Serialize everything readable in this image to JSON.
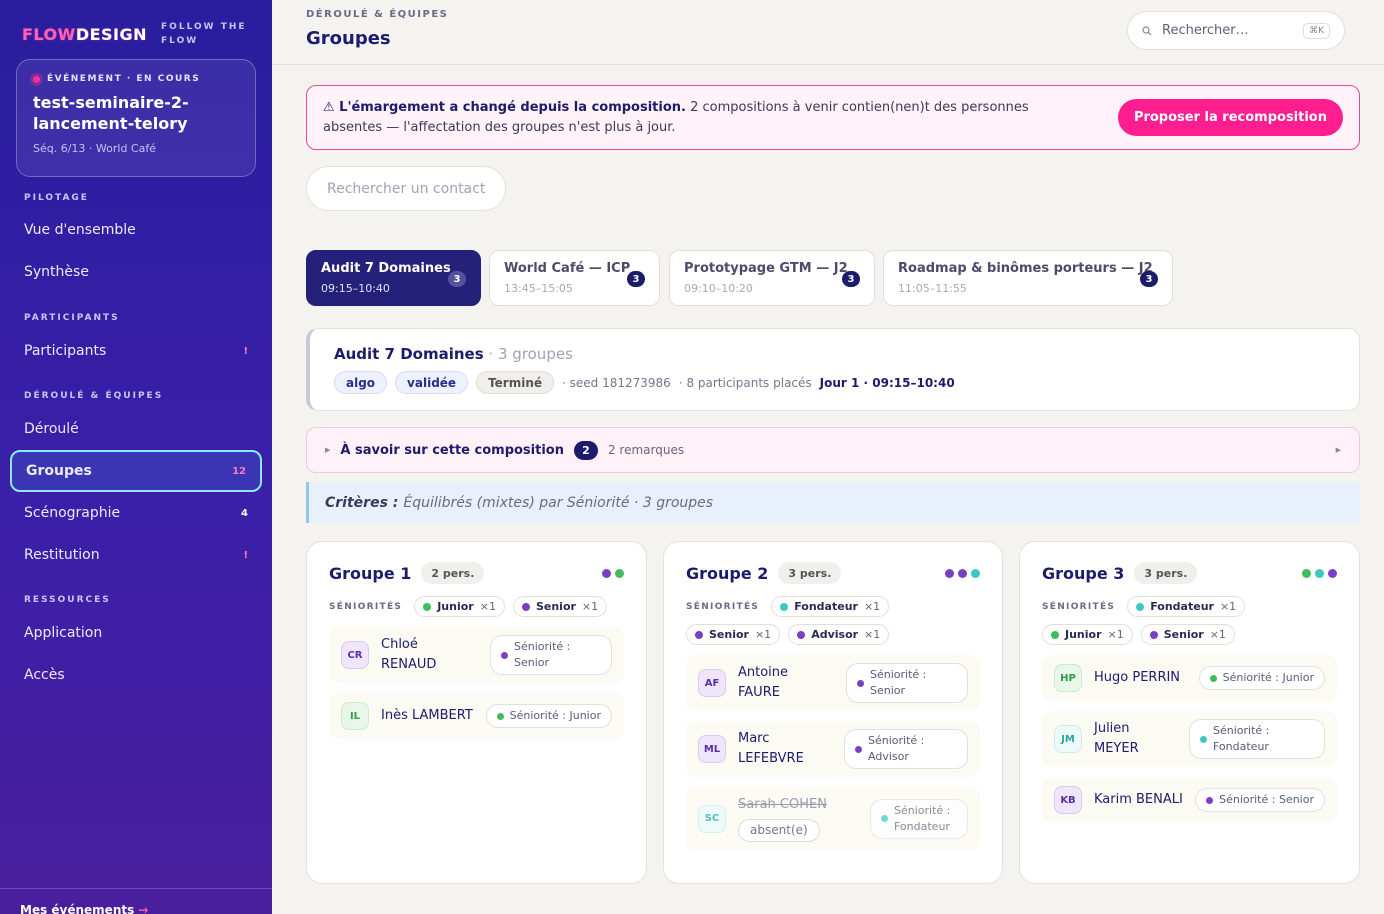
{
  "sidebar": {
    "logo_a": "FLOW",
    "logo_b": "DESIGN",
    "tagline_1": "FOLLOW THE",
    "tagline_2": "FLOW",
    "event": {
      "status": "ÉVÉNEMENT · EN COURS",
      "name": "test-seminaire-2-lancement-telory",
      "meta": "Séq. 6/13 · World Café"
    },
    "sections": {
      "pilotage": "PILOTAGE",
      "participants": "PARTICIPANTS",
      "deroule": "DÉROULÉ & ÉQUIPES",
      "ressources": "RESSOURCES"
    },
    "items": [
      {
        "label": "Vue d'ensemble",
        "badge": ""
      },
      {
        "label": "Synthèse",
        "badge": ""
      },
      {
        "label": "Participants",
        "badge": "!"
      },
      {
        "label": "Déroulé",
        "badge": ""
      },
      {
        "label": "Groupes",
        "badge": "12"
      },
      {
        "label": "Scénographie",
        "badge": "4"
      },
      {
        "label": "Restitution",
        "badge": "!"
      },
      {
        "label": "Application",
        "badge": ""
      },
      {
        "label": "Accès",
        "badge": ""
      }
    ],
    "footer": "Mes événements",
    "footer_arrow": "→"
  },
  "header": {
    "breadcrumb": "DÉROULÉ & ÉQUIPES",
    "title": "Groupes",
    "search_placeholder": "Rechercher…",
    "search_kbd": "⌘K"
  },
  "alert": {
    "title": "⚠ L'émargement a changé depuis la composition.",
    "text": " 2 compositions à venir contien(nen)t des personnes absentes — l'affectation des groupes n'est plus à jour.",
    "button": "Proposer la recomposition"
  },
  "contact_search": {
    "placeholder": "Rechercher un contact"
  },
  "tabs": [
    {
      "name": "Audit 7 Domaines",
      "time": "09:15–10:40",
      "count": "3"
    },
    {
      "name": "World Café — ICP",
      "time": "13:45–15:05",
      "count": "3"
    },
    {
      "name": "Prototypage GTM — J2",
      "time": "09:10–10:20",
      "count": "3"
    },
    {
      "name": "Roadmap & binômes porteurs — J2",
      "time": "11:05–11:55",
      "count": "3"
    }
  ],
  "composition": {
    "title": "Audit 7 Domaines",
    "groups": " · 3 groupes",
    "chip_algo": "algo",
    "chip_valid": "validée",
    "chip_done": "Terminé",
    "seed": "· seed 181273986",
    "placed": "· 8 participants placés",
    "day": "Jour 1 · 09:15–10:40"
  },
  "notes": {
    "title": "À savoir sur cette composition",
    "count": "2",
    "remarks": "2 remarques"
  },
  "criteria": {
    "label": "Critères :",
    "text": "Équilibrés (mixtes) par Séniorité · 3 groupes"
  },
  "colors": {
    "junior": "#3ebd5a",
    "senior": "#7b3fc4",
    "fondateur": "#3ec7c2",
    "advisor": "#7b3fc4",
    "accent": "#ff1e8f"
  },
  "groups": {
    "seniorities_label": "SÉNIORITÉS",
    "g1": {
      "title": "Groupe 1",
      "pers": "2 pers.",
      "tags": [
        {
          "name": "Junior",
          "x": "×1"
        },
        {
          "name": "Senior",
          "x": "×1"
        }
      ],
      "members": [
        {
          "initials": "CR",
          "first": "Chloé",
          "last": "RENAUD",
          "sen": "Séniorité :",
          "sen_val": "Senior"
        },
        {
          "initials": "IL",
          "name": "Inès LAMBERT",
          "sen_full": "Séniorité : Junior"
        }
      ]
    },
    "g2": {
      "title": "Groupe 2",
      "pers": "3 pers.",
      "tags": [
        {
          "name": "Fondateur",
          "x": "×1"
        },
        {
          "name": "Senior",
          "x": "×1"
        },
        {
          "name": "Advisor",
          "x": "×1"
        }
      ],
      "members": [
        {
          "initials": "AF",
          "first": "Antoine",
          "last": "FAURE",
          "sen": "Séniorité :",
          "sen_val": "Senior"
        },
        {
          "initials": "ML",
          "first": "Marc",
          "last": "LEFEBVRE",
          "sen": "Séniorité :",
          "sen_val": "Advisor"
        },
        {
          "initials": "SC",
          "name": "Sarah COHEN",
          "absent": "absent(e)",
          "sen": "Séniorité :",
          "sen_val": "Fondateur"
        }
      ]
    },
    "g3": {
      "title": "Groupe 3",
      "pers": "3 pers.",
      "tags": [
        {
          "name": "Fondateur",
          "x": "×1"
        },
        {
          "name": "Junior",
          "x": "×1"
        },
        {
          "name": "Senior",
          "x": "×1"
        }
      ],
      "members": [
        {
          "initials": "HP",
          "name": "Hugo PERRIN",
          "sen_full": "Séniorité : Junior"
        },
        {
          "initials": "JM",
          "first": "Julien",
          "last": "MEYER",
          "sen": "Séniorité :",
          "sen_val": "Fondateur"
        },
        {
          "initials": "KB",
          "name": "Karim BENALI",
          "sen_full": "Séniorité : Senior"
        }
      ]
    }
  }
}
